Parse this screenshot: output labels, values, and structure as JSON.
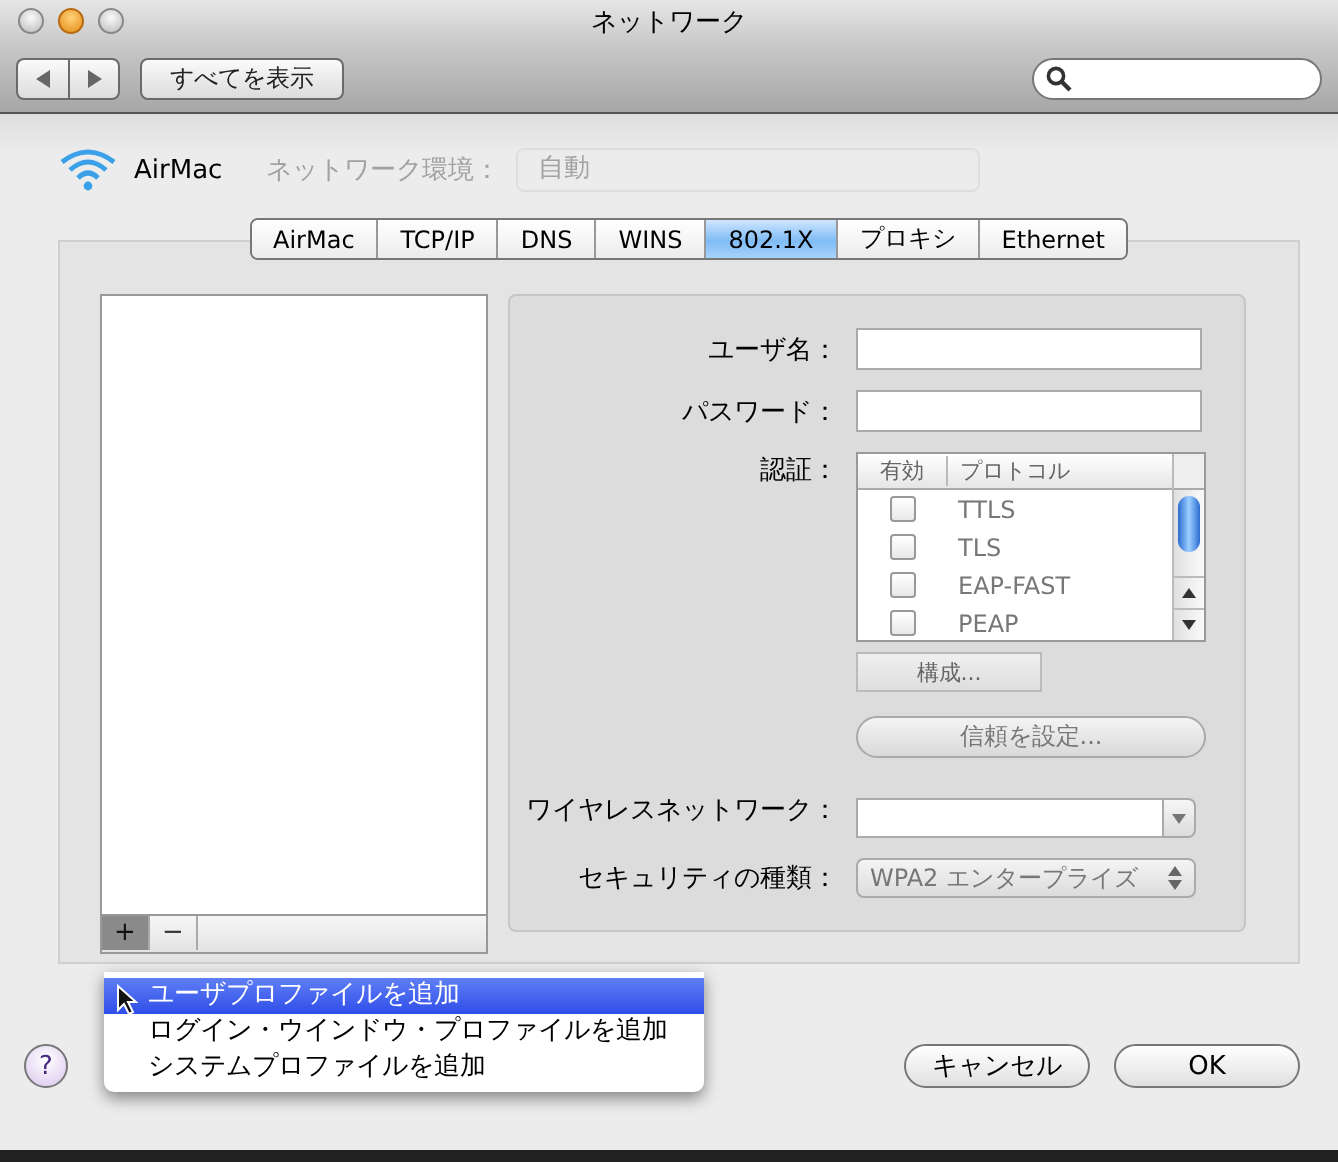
{
  "window": {
    "title": "ネットワーク"
  },
  "toolbar": {
    "show_all_button": "すべてを表示"
  },
  "header": {
    "service": "AirMac",
    "location_label": "ネットワーク環境：",
    "location_value": "自動"
  },
  "tabs": [
    {
      "label": "AirMac",
      "selected": false
    },
    {
      "label": "TCP/IP",
      "selected": false
    },
    {
      "label": "DNS",
      "selected": false
    },
    {
      "label": "WINS",
      "selected": false
    },
    {
      "label": "802.1X",
      "selected": true
    },
    {
      "label": "プロキシ",
      "selected": false
    },
    {
      "label": "Ethernet",
      "selected": false
    }
  ],
  "profile_list": {
    "add_button": "+",
    "remove_button": "−"
  },
  "form": {
    "username_label": "ユーザ名：",
    "password_label": "パスワード：",
    "auth_label": "認証：",
    "auth_columns": [
      "有効",
      "プロトコル"
    ],
    "protocols": [
      {
        "name": "TTLS",
        "checked": false
      },
      {
        "name": "TLS",
        "checked": false
      },
      {
        "name": "EAP-FAST",
        "checked": false
      },
      {
        "name": "PEAP",
        "checked": false
      }
    ],
    "configure_button": "構成...",
    "trust_button": "信頼を設定...",
    "wireless_label": "ワイヤレスネットワーク：",
    "security_label": "セキュリティの種類：",
    "security_value": "WPA2 エンタープライズ"
  },
  "add_menu": {
    "items": [
      {
        "label": "ユーザプロファイルを追加",
        "selected": true
      },
      {
        "label": "ログイン・ウインドウ・プロファイルを追加",
        "selected": false
      },
      {
        "label": "システムプロファイルを追加",
        "selected": false
      }
    ]
  },
  "buttons": {
    "help": "?",
    "cancel": "キャンセル",
    "ok": "OK"
  }
}
